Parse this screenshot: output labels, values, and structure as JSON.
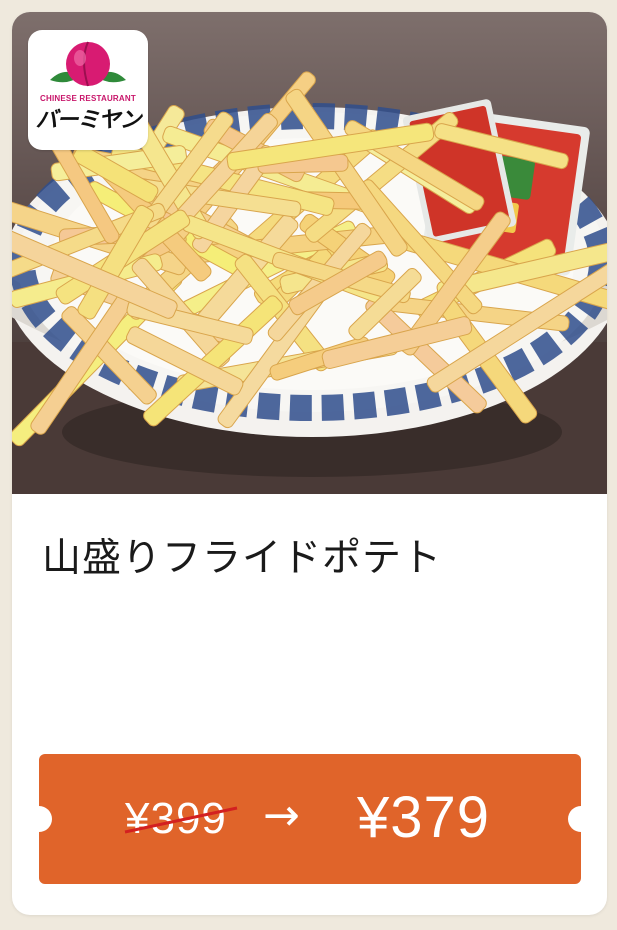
{
  "logo": {
    "subtitle": "CHINESE RESTAURANT",
    "name": "バーミヤン"
  },
  "item": {
    "title": "山盛りフライドポテト",
    "image_description_icon": "french-fries-photo"
  },
  "coupon": {
    "old_price": "¥399",
    "arrow": "→",
    "new_price": "¥379"
  },
  "colors": {
    "background": "#efe9dd",
    "ticket": "#e0642a",
    "brand_pink": "#c8156a",
    "brand_green": "#2f8a3a"
  }
}
